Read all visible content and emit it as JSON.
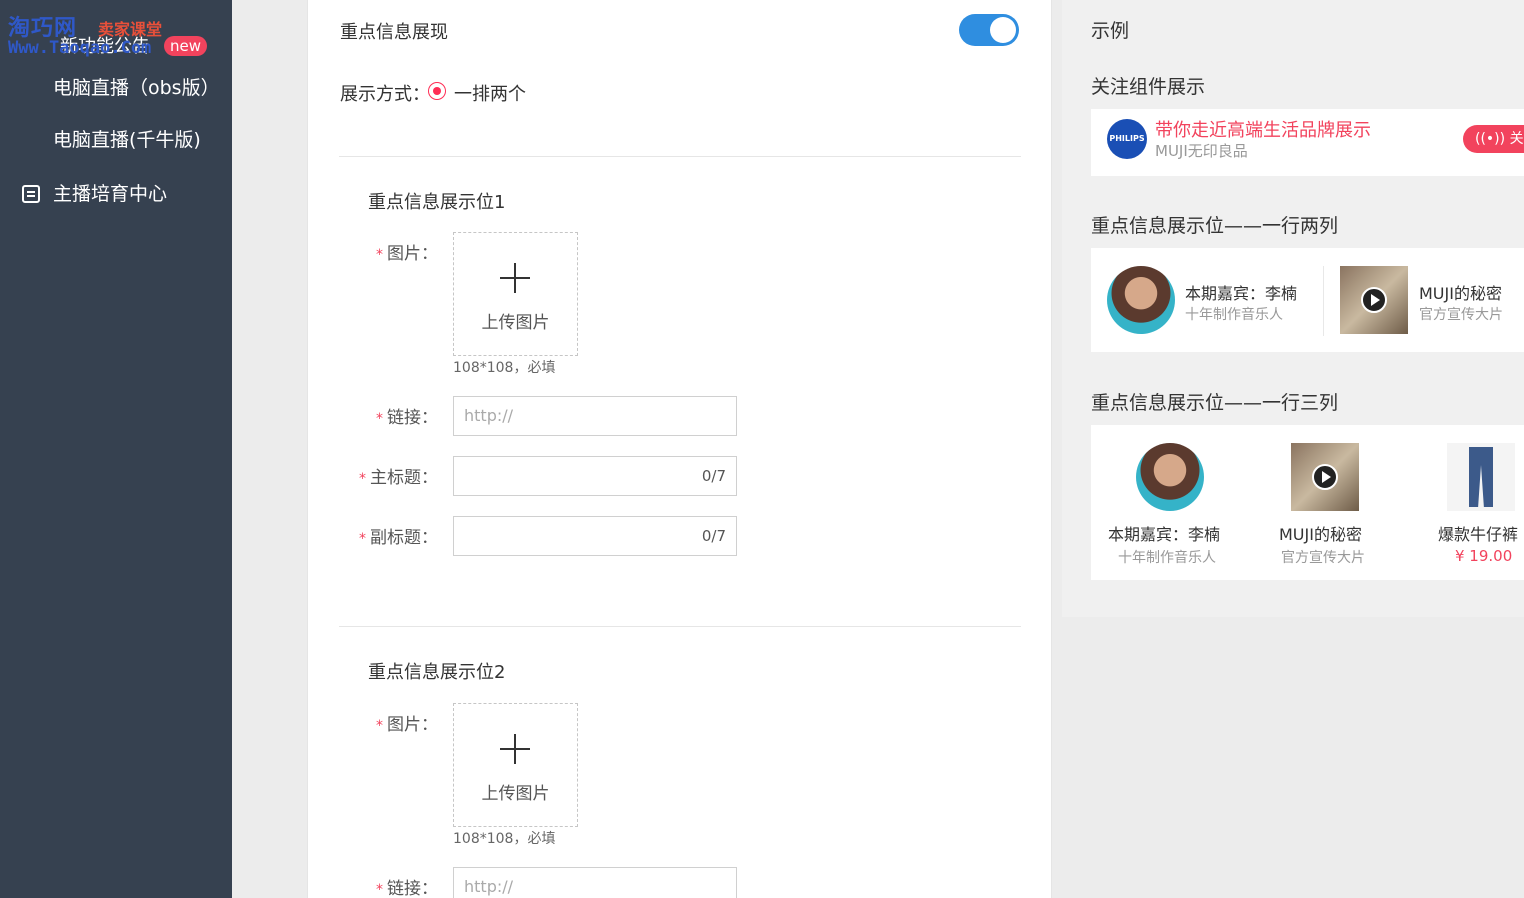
{
  "watermark": {
    "brand": "淘巧网",
    "tag": "卖家课堂",
    "url": "Www.Taoqao.Com",
    "under_text": "新功能公告",
    "badge": "new"
  },
  "sidebar": {
    "items": [
      {
        "label": "电脑直播（obs版）"
      },
      {
        "label": "电脑直播(千牛版)"
      },
      {
        "label": "主播培育中心",
        "icon": "document-icon"
      }
    ]
  },
  "form": {
    "title": "重点信息展现",
    "toggle_on": true,
    "display_mode_label": "展示方式：",
    "display_mode_value": "一排两个",
    "slots": [
      {
        "title": "重点信息展示位1",
        "image_label": "图片：",
        "upload_text": "上传图片",
        "image_hint": "108*108，必填",
        "link_label": "链接：",
        "link_placeholder": "http://",
        "main_title_label": "主标题：",
        "main_title_count": "0/7",
        "subtitle_label": "副标题：",
        "subtitle_count": "0/7"
      },
      {
        "title": "重点信息展示位2",
        "image_label": "图片：",
        "upload_text": "上传图片",
        "image_hint": "108*108，必填",
        "link_label": "链接：",
        "link_placeholder": "http://"
      }
    ],
    "required_mark": "*"
  },
  "preview": {
    "title": "示例",
    "follow_section": {
      "title": "关注组件展示",
      "logo": "PHILIPS",
      "headline": "带你走近高端生活品牌展示",
      "sub": "MUJI无印良品",
      "button": "关注"
    },
    "two_col": {
      "title": "重点信息展示位——一行两列",
      "items": [
        {
          "name": "本期嘉宾：李楠",
          "sub": "十年制作音乐人"
        },
        {
          "name": "MUJI的秘密",
          "sub": "官方宣传大片"
        }
      ]
    },
    "three_col": {
      "title": "重点信息展示位——一行三列",
      "items": [
        {
          "name": "本期嘉宾：李楠",
          "sub": "十年制作音乐人"
        },
        {
          "name": "MUJI的秘密",
          "sub": "官方宣传大片"
        },
        {
          "name": "爆款牛仔裤",
          "price": "¥ 19.00"
        }
      ]
    }
  },
  "colors": {
    "sidebar_bg": "#364150",
    "accent_blue": "#2f8ee0",
    "accent_red": "#f2435d"
  }
}
